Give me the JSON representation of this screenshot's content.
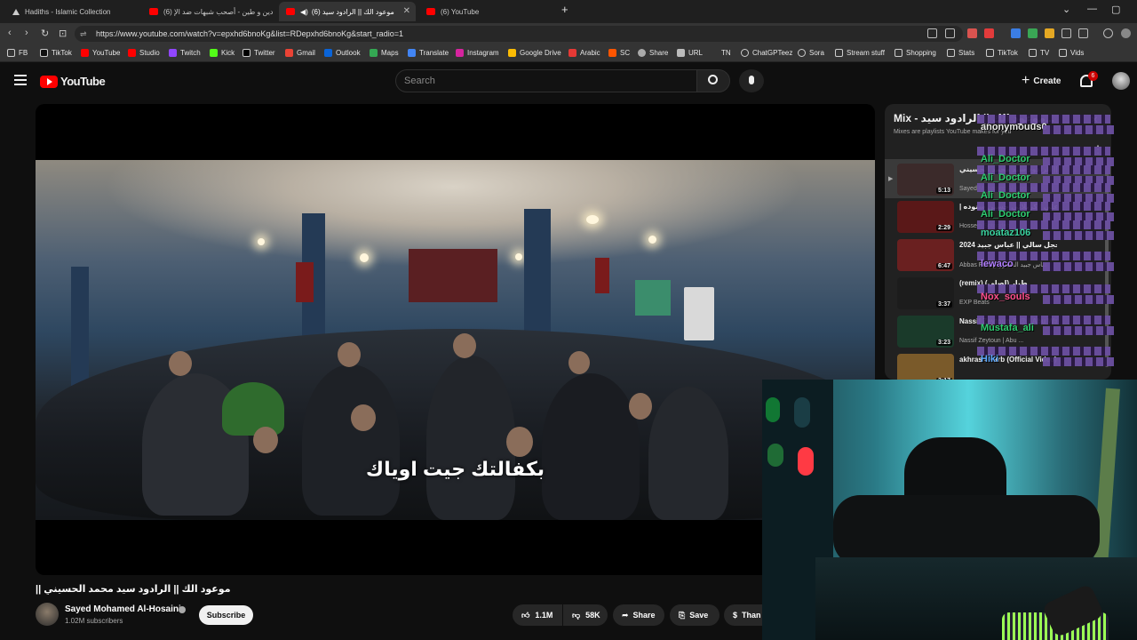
{
  "tabs": [
    {
      "label": "Hadiths - Islamic Collection",
      "active": false
    },
    {
      "label": "(6) دين و طين - أصحب شبهات ضد الإ",
      "active": false
    },
    {
      "label": "(6) موعود الك || الرادود سيد",
      "active": true
    },
    {
      "label": "(6) YouTube",
      "active": false
    }
  ],
  "address_bar": {
    "url": "https://www.youtube.com/watch?v=epxhd6bnoKg&list=RDepxhd6bnoKg&start_radio=1"
  },
  "bookmarks": [
    "FB",
    "TikTok",
    "YouTube",
    "Studio",
    "Twitch",
    "Kick",
    "Twitter",
    "Gmail",
    "Outlook",
    "Maps",
    "Translate",
    "Instagram",
    "Google Drive",
    "Arabic",
    "SC",
    "Share",
    "URL",
    "TN",
    "ChatGPTeez",
    "Sora",
    "Stream stuff",
    "Shopping",
    "Stats",
    "TikTok",
    "TV",
    "Vids"
  ],
  "youtube": {
    "logo_text": "YouTube",
    "search_placeholder": "Search",
    "create_label": "Create",
    "notif_count": "6"
  },
  "video": {
    "subtitle": "بكفالتك جيت اوياك",
    "title": "موعود الك || الرادود سيد محمد الحسيني ||",
    "channel": "Sayed Mohamed Al-Hosaini",
    "subscribers": "1.02M subscribers",
    "subscribe_label": "Subscribe",
    "likes": "1.1M",
    "dislikes": "58K",
    "share_label": "Share",
    "save_label": "Save",
    "thanks_label": "Than"
  },
  "playlist": {
    "title": "Mix - موعود الك || الرادود سيد...",
    "subtitle": "Mixes are playlists YouTube makes for you",
    "items": [
      {
        "title": "موعود الك || الرادود سيد محمد الحسيني",
        "channel": "Sayed Mohamed Al-Hosaini",
        "duration": "5:13"
      },
      {
        "title": "| عباس علي | كربلائي حسين سنوده",
        "channel": "Hossein Sotoodeh",
        "duration": "2:29"
      },
      {
        "title": "2024 احجل سالي || عباس جبيد",
        "channel": "Abbas Faid || عباس جبيد الشمري",
        "duration": "6:47"
      },
      {
        "title": "(remix) طيار (اصلي)",
        "channel": "EXP Beats",
        "duration": "3:37"
      },
      {
        "title": "Nassif Zeytoun & @ | Abu Ward - Kazdoura (Lyrics)",
        "channel": "Nassif Zeytoun | Abu ...",
        "duration": "3:23"
      },
      {
        "title": "akhras - Harb (Official Video) | الأخرس - حرب",
        "channel": "",
        "duration": "3:17"
      }
    ]
  },
  "chat": [
    {
      "name": "anonymouus0",
      "color": "#e8e8e8"
    },
    {
      "name": "Ali_Doctor",
      "color": "#2ecc71"
    },
    {
      "name": "Ali_Doctor",
      "color": "#2ecc71"
    },
    {
      "name": "Ali_Doctor",
      "color": "#2ecc71"
    },
    {
      "name": "Ali_Doctor",
      "color": "#2ecc71"
    },
    {
      "name": "moataz106",
      "color": "#3ad29f"
    },
    {
      "name": "lewaco",
      "color": "#b07cff"
    },
    {
      "name": "Nox_souls",
      "color": "#ff4d8d"
    },
    {
      "name": "Mustafa_ali",
      "color": "#2ecc71"
    },
    {
      "name": "Hiki",
      "color": "#5da9ff"
    }
  ],
  "colors": {
    "youtube_red": "#ff0000",
    "background": "#0f0f0f"
  }
}
